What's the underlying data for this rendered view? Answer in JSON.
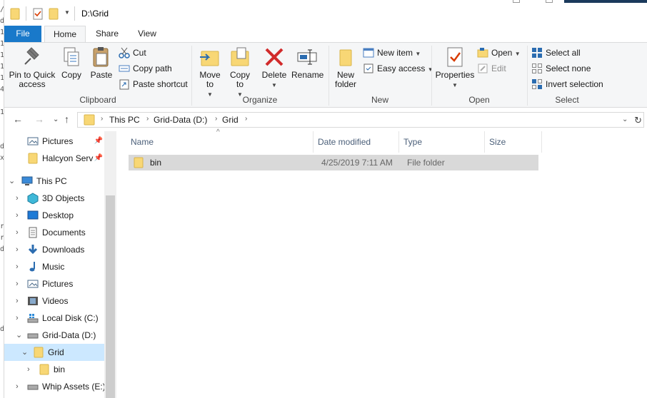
{
  "window": {
    "title": "D:\\Grid"
  },
  "tabs": [
    {
      "label": "File"
    },
    {
      "label": "Home"
    },
    {
      "label": "Share"
    },
    {
      "label": "View"
    }
  ],
  "ribbon": {
    "clipboard": {
      "label": "Clipboard",
      "pin_label": "Pin to Quick access",
      "copy_label": "Copy",
      "paste_label": "Paste",
      "cut_label": "Cut",
      "copy_path_label": "Copy path",
      "paste_shortcut_label": "Paste shortcut"
    },
    "organize": {
      "label": "Organize",
      "move_to_label": "Move to",
      "copy_to_label": "Copy to",
      "delete_label": "Delete",
      "rename_label": "Rename"
    },
    "new": {
      "label": "New",
      "new_folder_label": "New folder",
      "new_item_label": "New item",
      "easy_access_label": "Easy access"
    },
    "open": {
      "label": "Open",
      "properties_label": "Properties",
      "open_label": "Open",
      "edit_label": "Edit"
    },
    "select": {
      "label": "Select",
      "select_all_label": "Select all",
      "select_none_label": "Select none",
      "invert_label": "Invert selection"
    }
  },
  "address": {
    "crumbs": [
      "This PC",
      "Grid-Data (D:)",
      "Grid"
    ]
  },
  "nav": {
    "items": [
      {
        "label": "Pictures"
      },
      {
        "label": "Halcyon Serv"
      },
      {
        "label": "This PC"
      },
      {
        "label": "3D Objects"
      },
      {
        "label": "Desktop"
      },
      {
        "label": "Documents"
      },
      {
        "label": "Downloads"
      },
      {
        "label": "Music"
      },
      {
        "label": "Pictures"
      },
      {
        "label": "Videos"
      },
      {
        "label": "Local Disk (C:)"
      },
      {
        "label": "Grid-Data (D:)"
      },
      {
        "label": "Grid"
      },
      {
        "label": "bin"
      },
      {
        "label": "Whip Assets (E:)"
      }
    ]
  },
  "columns": [
    "Name",
    "Date modified",
    "Type",
    "Size"
  ],
  "files": [
    {
      "name": "bin",
      "date": "4/25/2019 7:11 AM",
      "type": "File folder",
      "size": ""
    }
  ],
  "colors": {
    "file_tab": "#1979ca",
    "selected_nav": "#cce8ff",
    "selected_row": "#d9d9d9",
    "folder": "#f8d775"
  }
}
